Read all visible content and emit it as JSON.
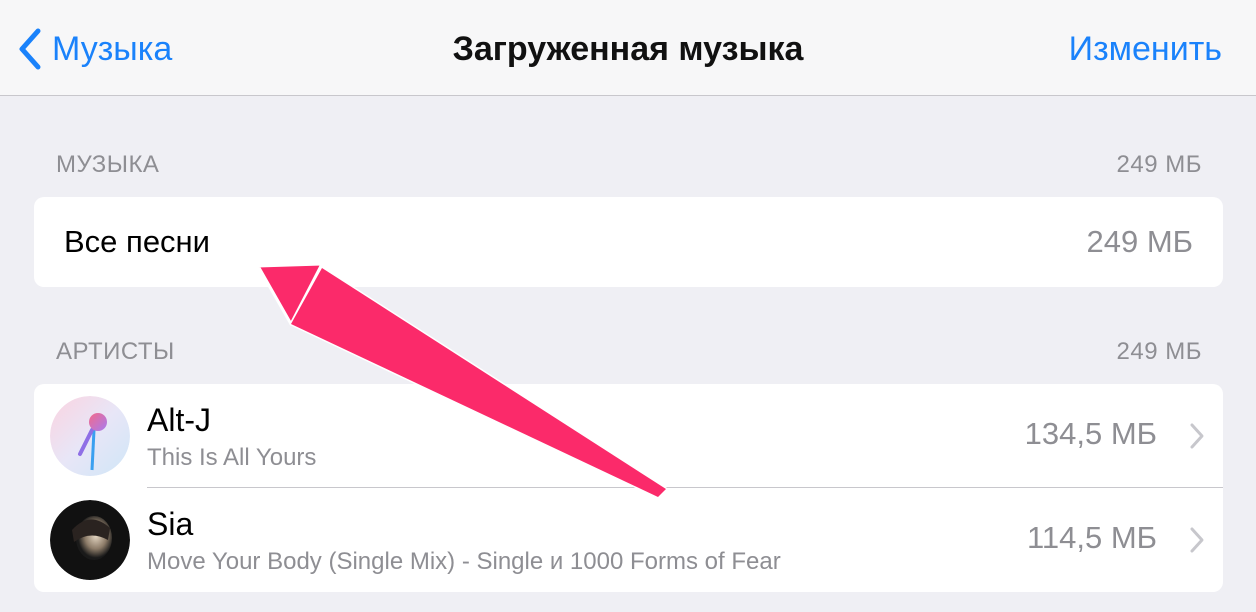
{
  "navbar": {
    "back_label": "Музыка",
    "title": "Загруженная музыка",
    "edit_label": "Изменить"
  },
  "music_section": {
    "header": "МУЗЫКА",
    "header_size": "249 МБ",
    "all_songs_label": "Все песни",
    "all_songs_size": "249 МБ"
  },
  "artists_section": {
    "header": "АРТИСТЫ",
    "header_size": "249 МБ",
    "items": [
      {
        "name": "Alt-J",
        "album": "This Is All Yours",
        "size": "134,5 МБ",
        "avatar_icon": "microphone-icon"
      },
      {
        "name": "Sia",
        "album": "Move Your Body (Single Mix) - Single и 1000 Forms of Fear",
        "size": "114,5 МБ",
        "avatar_icon": "artist-photo"
      }
    ]
  },
  "colors": {
    "accent": "#1a82fb",
    "arrow": "#fb2a6a",
    "background": "#efeff4"
  }
}
